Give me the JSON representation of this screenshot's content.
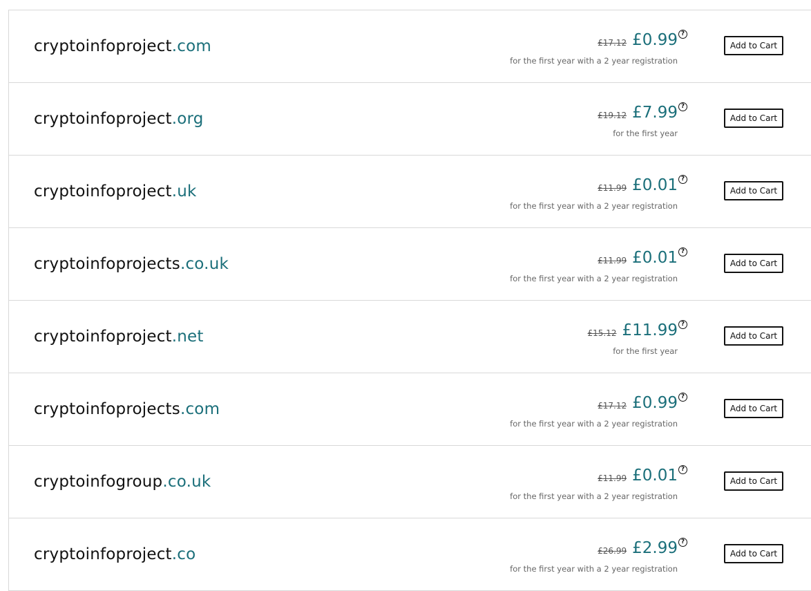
{
  "results": [
    {
      "name": "cryptoinfoproject",
      "tld": ".com",
      "old_price": "£17.12",
      "price": "£0.99",
      "note": "for the first year with a 2 year registration",
      "button": "Add to Cart"
    },
    {
      "name": "cryptoinfoproject",
      "tld": ".org",
      "old_price": "£19.12",
      "price": "£7.99",
      "note": "for the first year",
      "button": "Add to Cart"
    },
    {
      "name": "cryptoinfoproject",
      "tld": ".uk",
      "old_price": "£11.99",
      "price": "£0.01",
      "note": "for the first year with a 2 year registration",
      "button": "Add to Cart"
    },
    {
      "name": "cryptoinfoprojects",
      "tld": ".co.uk",
      "old_price": "£11.99",
      "price": "£0.01",
      "note": "for the first year with a 2 year registration",
      "button": "Add to Cart"
    },
    {
      "name": "cryptoinfoproject",
      "tld": ".net",
      "old_price": "£15.12",
      "price": "£11.99",
      "note": "for the first year",
      "button": "Add to Cart"
    },
    {
      "name": "cryptoinfoprojects",
      "tld": ".com",
      "old_price": "£17.12",
      "price": "£0.99",
      "note": "for the first year with a 2 year registration",
      "button": "Add to Cart"
    },
    {
      "name": "cryptoinfogroup",
      "tld": ".co.uk",
      "old_price": "£11.99",
      "price": "£0.01",
      "note": "for the first year with a 2 year registration",
      "button": "Add to Cart"
    },
    {
      "name": "cryptoinfoproject",
      "tld": ".co",
      "old_price": "£26.99",
      "price": "£2.99",
      "note": "for the first year with a 2 year registration",
      "button": "Add to Cart"
    }
  ],
  "icons": {
    "help": "question-circle-icon",
    "help_glyph": "?"
  },
  "colors": {
    "tld": "#1b6f7a",
    "price": "#1b6f7a",
    "button_border": "#111111",
    "divider": "#d8d8d8"
  }
}
